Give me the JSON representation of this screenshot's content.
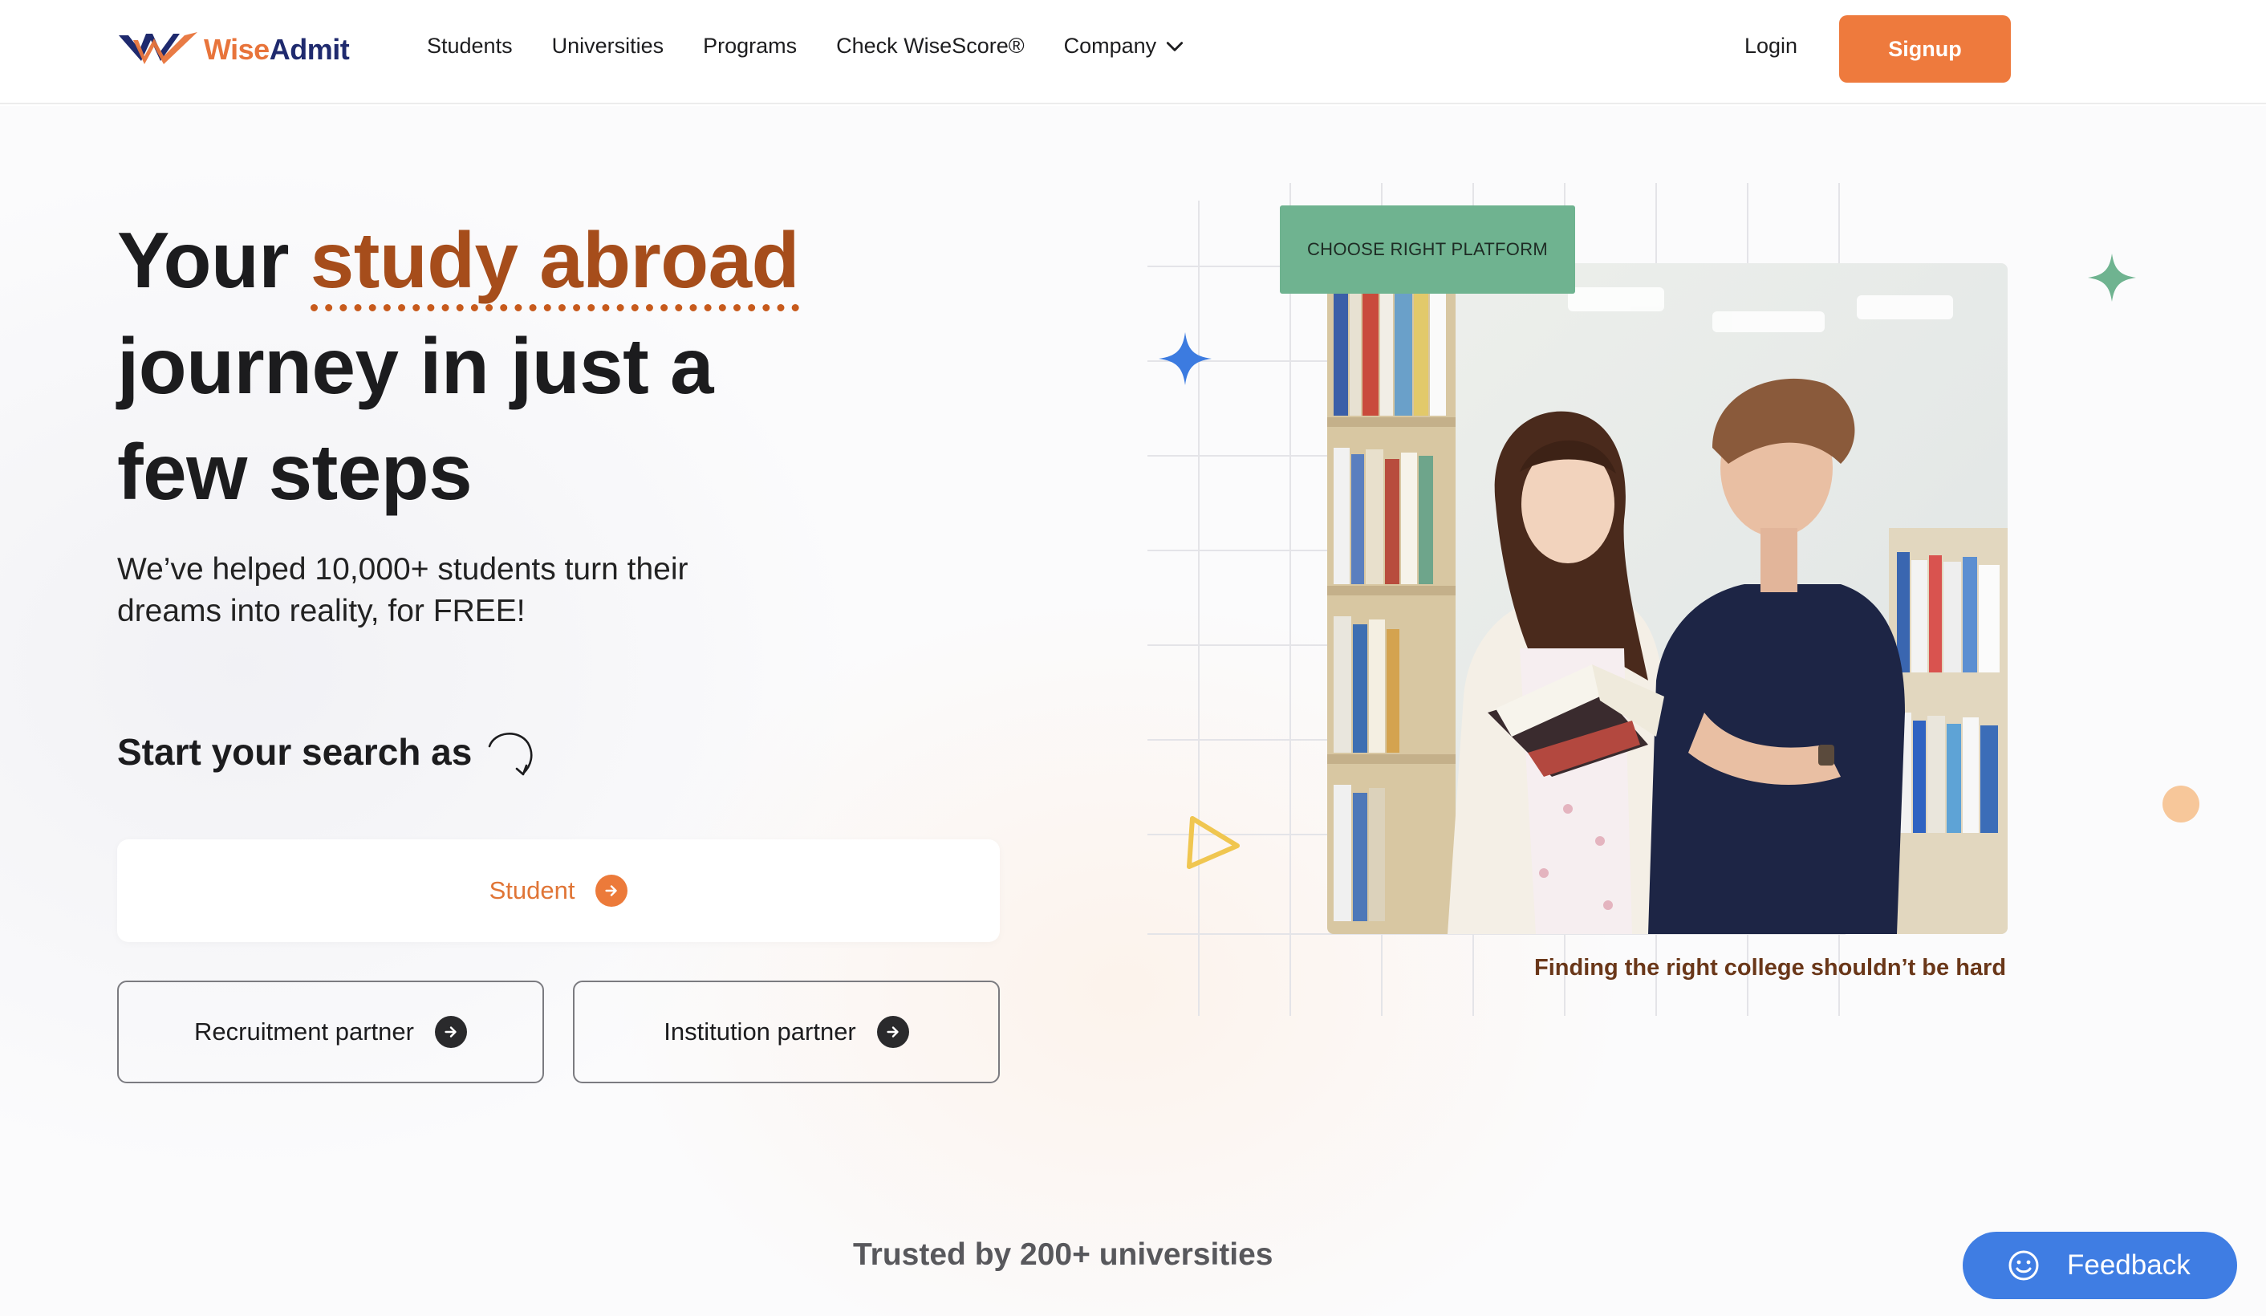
{
  "nav": {
    "logo_wise": "Wise",
    "logo_admit": "Admit",
    "links": [
      "Students",
      "Universities",
      "Programs",
      "Check WiseScore®",
      "Company"
    ],
    "login": "Login",
    "signup": "Signup"
  },
  "hero": {
    "headline_pre": "Your ",
    "headline_accent": "study abroad",
    "headline_line2": "journey in just a",
    "headline_line3": "few steps",
    "subcopy": "We’ve helped 10,000+ students turn their dreams into reality, for FREE!",
    "search_as": "Start your search as",
    "student_button": "Student",
    "recruitment_button": "Recruitment partner",
    "institution_button": "Institution partner"
  },
  "visual": {
    "badge": "CHOOSE RIGHT PLATFORM",
    "caption": "Finding the right college shouldn’t be hard"
  },
  "footer": {
    "trusted": "Trusted by 200+ universities",
    "feedback": "Feedback"
  },
  "colors": {
    "brand_orange": "#ee7a3d",
    "brand_navy": "#1f2a6e",
    "accent_text": "#a64d1b",
    "badge_green": "#6fb390",
    "feedback_blue": "#3f7de3"
  },
  "icons": [
    "wiseadmit-logo-icon",
    "chevron-down-icon",
    "curved-arrow-icon",
    "arrow-right-circle-icon",
    "sparkle-star-icon",
    "triangle-outline-icon",
    "dot-icon",
    "smiley-icon"
  ]
}
